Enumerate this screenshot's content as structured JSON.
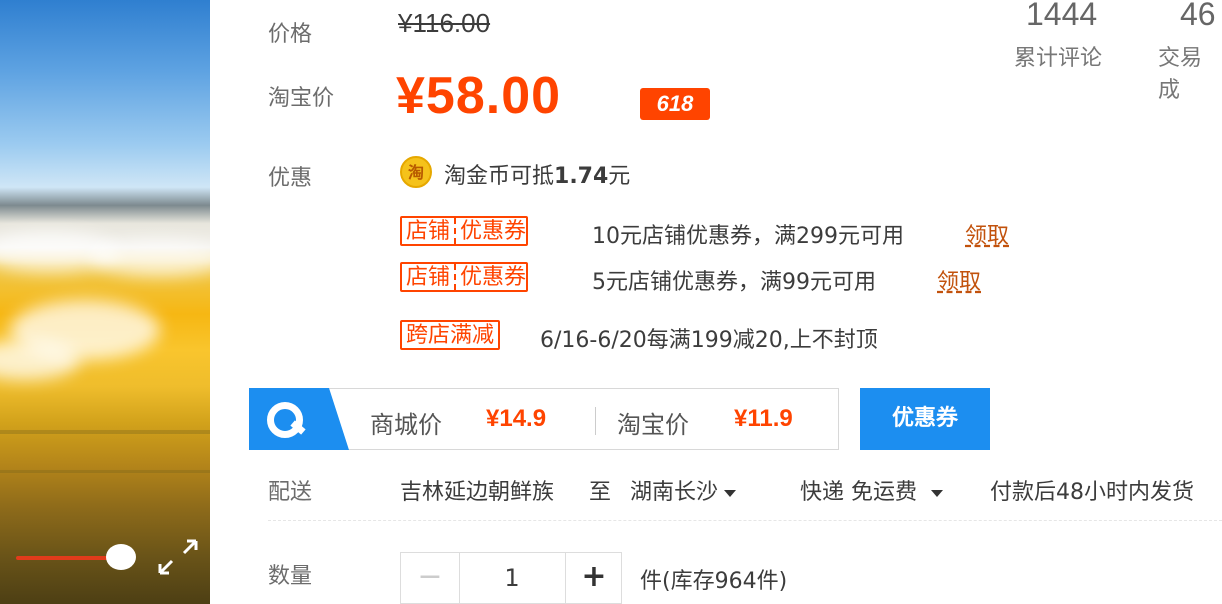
{
  "price": {
    "label": "价格",
    "original": "¥116.00"
  },
  "taobao_price": {
    "label": "淘宝价",
    "value": "¥58.00",
    "badge": "618"
  },
  "stats": {
    "comments_count": "1444",
    "comments_label": "累计评论",
    "trades_count": "46",
    "trades_label": "交易成"
  },
  "promotions": {
    "label": "优惠",
    "coin_icon": "淘",
    "coin_text_prefix": "淘金币可抵",
    "coin_amount": "1.74",
    "coin_text_suffix": "元",
    "coupons": [
      {
        "tag_left": "店铺",
        "tag_right": "优惠券",
        "desc": "10元店铺优惠券，满299元可用",
        "action": "领取"
      },
      {
        "tag_left": "店铺",
        "tag_right": "优惠券",
        "desc": "5元店铺优惠券，满99元可用",
        "action": "领取"
      }
    ],
    "cross_store": {
      "tag": "跨店满减",
      "desc": "6/16-6/20每满199减20,上不封顶"
    }
  },
  "compare_bar": {
    "mall_label": "商城价",
    "mall_value": "¥14.9",
    "taobao_label": "淘宝价",
    "taobao_value": "¥11.9",
    "coupon_button": "优惠券"
  },
  "delivery": {
    "label": "配送",
    "from": "吉林延边朝鲜族",
    "to_word": "至",
    "destination": "湖南长沙",
    "shipping": "快递 免运费",
    "dispatch": "付款后48小时内发货"
  },
  "quantity": {
    "label": "数量",
    "minus": "−",
    "value": "1",
    "plus": "+",
    "stock": "件(库存964件)"
  },
  "colors": {
    "accent": "#ff4400",
    "blue": "#1c8ef0"
  },
  "video": {
    "progress": 0.55
  }
}
